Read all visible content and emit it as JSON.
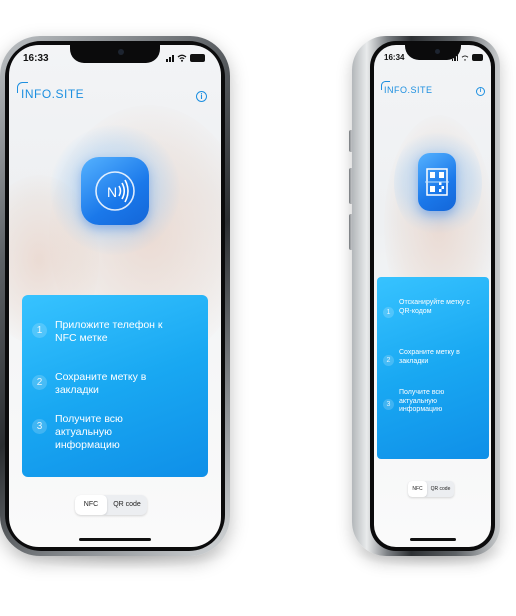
{
  "phone_front": {
    "status_time": "16:33",
    "logo": "INFO.SITE",
    "info_icon": "info-icon",
    "app_icon": "nfc-icon",
    "steps": [
      {
        "number": "1",
        "text": "Приложите телефон к NFC метке"
      },
      {
        "number": "2",
        "text": "Сохраните метку в закладки"
      },
      {
        "number": "3",
        "text": "Получите всю актуальную информацию"
      }
    ],
    "segmented": {
      "options": [
        "NFC",
        "QR code"
      ],
      "selected": "NFC"
    }
  },
  "phone_angled": {
    "status_time": "16:34",
    "logo": "INFO.SITE",
    "info_icon": "info-icon",
    "app_icon": "qr-code-icon",
    "steps": [
      {
        "number": "1",
        "text": "Отсканируйте метку с QR-кодом"
      },
      {
        "number": "2",
        "text": "Сохраните метку в закладки"
      },
      {
        "number": "3",
        "text": "Получите всю актуальную информацию"
      }
    ],
    "segmented": {
      "options": [
        "NFC",
        "QR code"
      ],
      "selected": "NFC"
    }
  },
  "colors": {
    "brand": "#1d8fe0",
    "card_gradient_start": "#37c3ff",
    "card_gradient_end": "#0f8fe8",
    "app_icon": "#1a78ea"
  }
}
